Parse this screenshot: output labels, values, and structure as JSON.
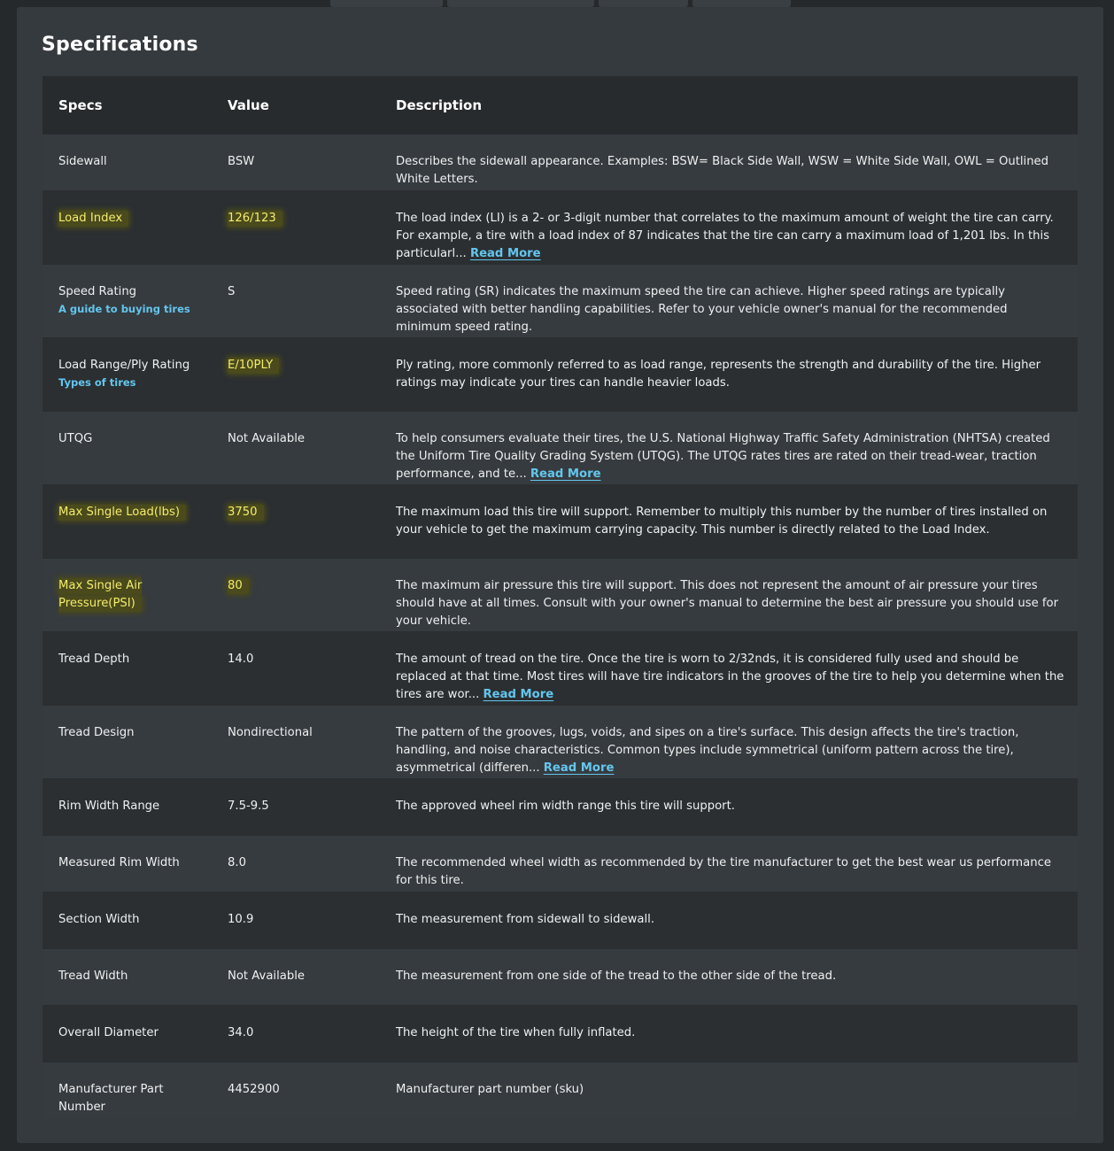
{
  "title": "Specifications",
  "columns": {
    "spec": "Specs",
    "value": "Value",
    "description": "Description"
  },
  "rows": [
    {
      "spec": "Sidewall",
      "value": "BSW",
      "description": "Describes the sidewall appearance. Examples: BSW= Black Side Wall, WSW = White Side Wall, OWL = Outlined White Letters."
    },
    {
      "spec": "Load Index",
      "value": "126/123",
      "description": "The load index (LI) is a 2- or 3-digit number that correlates to the maximum amount of weight the tire can carry. For example, a tire with a load index of 87 indicates that the tire can carry a maximum load of 1,201 lbs. In this particularl...",
      "read_more": "Read More"
    },
    {
      "spec": "Speed Rating",
      "sub_link": "A guide to buying tires",
      "value": "S",
      "description": "Speed rating (SR) indicates the maximum speed the tire can achieve. Higher speed ratings are typically associated with better handling capabilities. Refer to your vehicle owner's manual for the recommended minimum speed rating."
    },
    {
      "spec": "Load Range/Ply Rating",
      "sub_link": "Types of tires",
      "value": "E/10PLY",
      "description": "Ply rating, more commonly referred to as load range, represents the strength and durability of the tire. Higher ratings may indicate your tires can handle heavier loads."
    },
    {
      "spec": "UTQG",
      "value": "Not Available",
      "description": "To help consumers evaluate their tires, the U.S. National Highway Traffic Safety Administration (NHTSA) created the Uniform Tire Quality Grading System (UTQG). The UTQG rates tires are rated on their tread-wear, traction performance, and te...",
      "read_more": "Read More"
    },
    {
      "spec": "Max Single Load(lbs)",
      "value": "3750",
      "description": "The maximum load this tire will support. Remember to multiply this number by the number of tires installed on your vehicle to get the maximum carrying capacity. This number is directly related to the Load Index."
    },
    {
      "spec": "Max Single Air Pressure(PSI)",
      "value": "80",
      "description": "The maximum air pressure this tire will support. This does not represent the amount of air pressure your tires should have at all times. Consult with your owner's manual to determine the best air pressure you should use for your vehicle."
    },
    {
      "spec": "Tread Depth",
      "value": "14.0",
      "description": "The amount of tread on the tire. Once the tire is worn to 2/32nds, it is considered fully used and should be replaced at that time. Most tires will have tire indicators in the grooves of the tire to help you determine when the tires are wor...",
      "read_more": "Read More"
    },
    {
      "spec": "Tread Design",
      "value": "Nondirectional",
      "description": "The pattern of the grooves, lugs, voids, and sipes on a tire's surface. This design affects the tire's traction, handling, and noise characteristics. Common types include symmetrical (uniform pattern across the tire), asymmetrical (differen...",
      "read_more": "Read More"
    },
    {
      "spec": "Rim Width Range",
      "value": "7.5-9.5",
      "description": "The approved wheel rim width range this tire will support."
    },
    {
      "spec": "Measured Rim Width",
      "value": "8.0",
      "description": "The recommended wheel width as recommended by the tire manufacturer to get the best wear us performance for this tire."
    },
    {
      "spec": "Section Width",
      "value": "10.9",
      "description": "The measurement from sidewall to sidewall."
    },
    {
      "spec": "Tread Width",
      "value": "Not Available",
      "description": "The measurement from one side of the tread to the other side of the tread."
    },
    {
      "spec": "Overall Diameter",
      "value": "34.0",
      "description": "The height of the tire when fully inflated."
    },
    {
      "spec": "Manufacturer Part Number",
      "value": "4452900",
      "description": "Manufacturer part number (sku)"
    }
  ]
}
